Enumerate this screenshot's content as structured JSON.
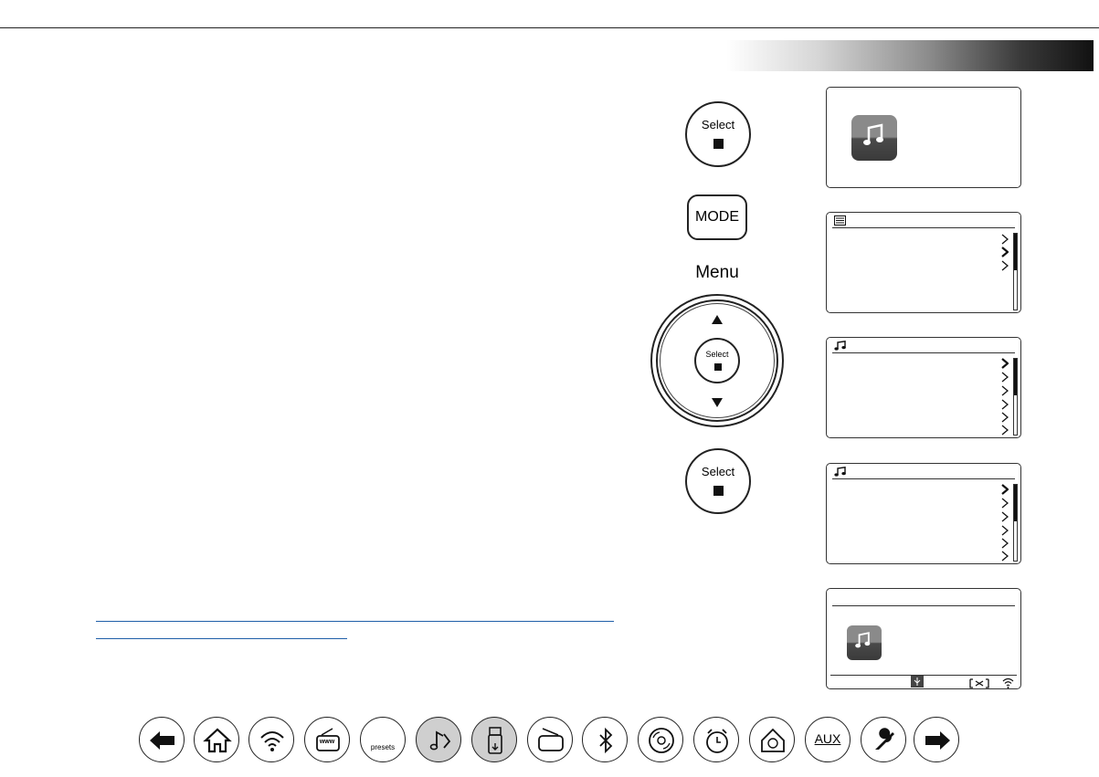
{
  "buttons": {
    "select_label": "Select",
    "mode_label": "MODE",
    "menu_label": "Menu",
    "dial_select_label": "Select"
  },
  "nav": {
    "presets_label": "presets",
    "aux_label": "AUX",
    "www_label": "www"
  }
}
